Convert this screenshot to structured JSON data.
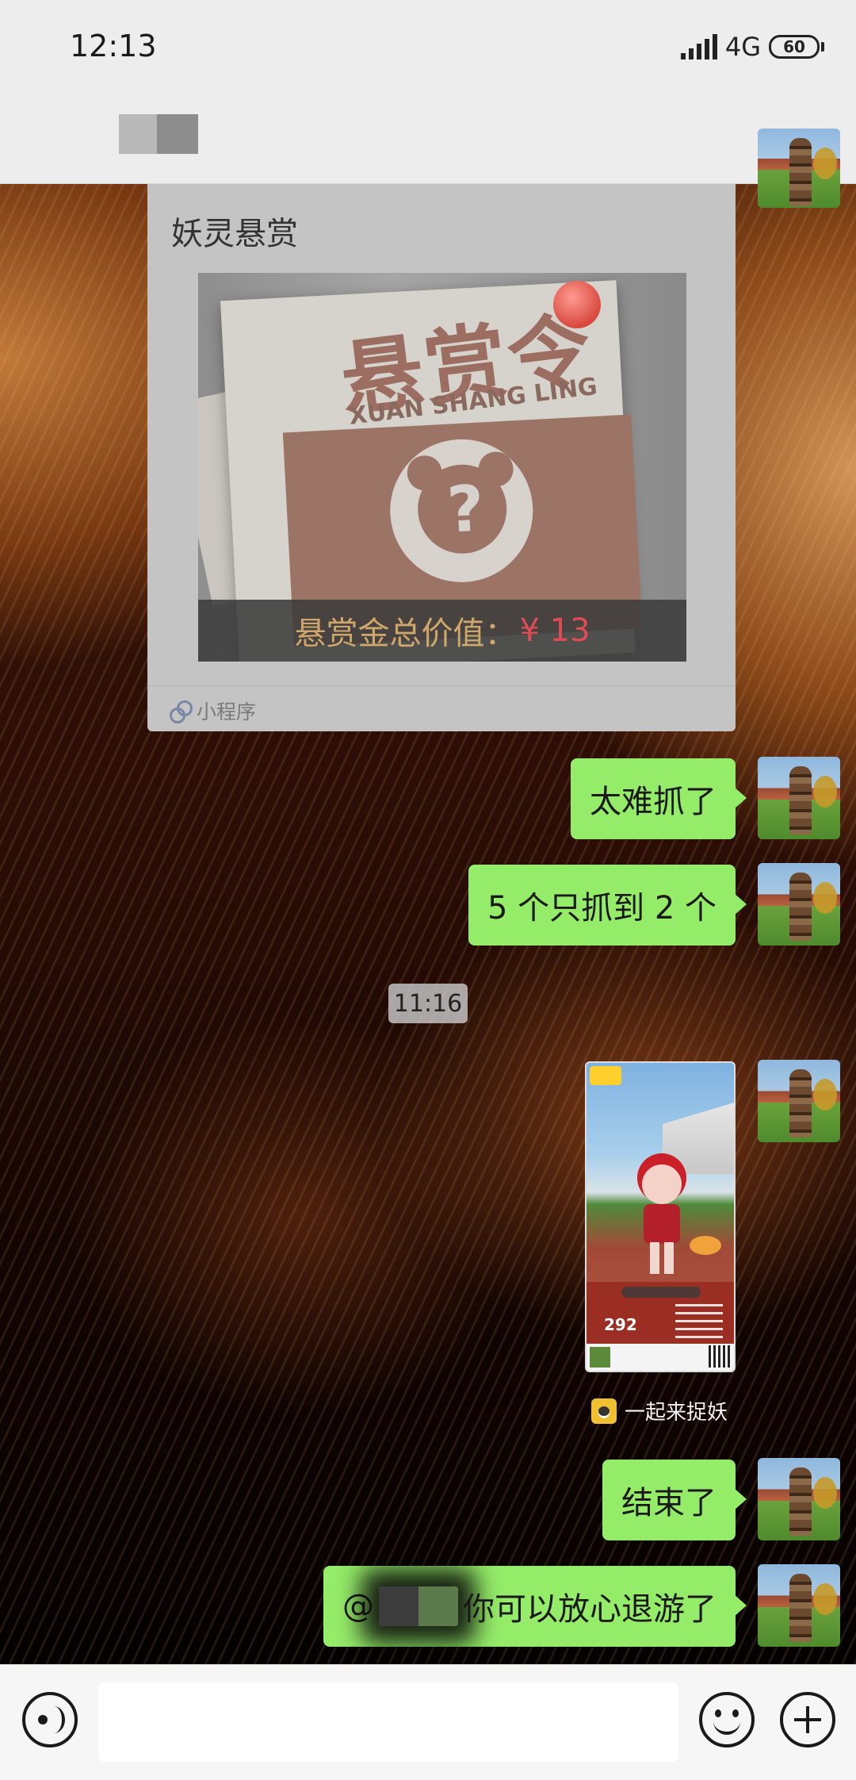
{
  "status_bar": {
    "time": "12:13",
    "network": "4G",
    "battery": "60"
  },
  "header": {
    "more_icon": "more-dots-icon"
  },
  "messages": {
    "mini_program": {
      "title": "妖灵悬赏",
      "poster": {
        "headline": "悬赏令",
        "subtitle": "XUAN SHANG LING",
        "question_mark": "?",
        "prize_label": "悬赏金总价值：",
        "prize_amount": "¥ 13"
      },
      "footer_label": "小程序"
    },
    "msg1": "太难抓了",
    "msg2": "5 个只抓到 2 个",
    "timestamp": "11:16",
    "game_card": {
      "score": "292",
      "source_name": "一起来捉妖"
    },
    "msg3": "结束了",
    "msg4_prefix": "@",
    "msg4_text": "你可以放心退游了"
  },
  "input_bar": {
    "value": "",
    "icons": [
      "voice-icon",
      "emoji-icon",
      "plus-icon"
    ]
  },
  "colors": {
    "bubble_green": "#95ec69",
    "bar_gray": "#ededed",
    "prize_red": "#e04b55"
  }
}
